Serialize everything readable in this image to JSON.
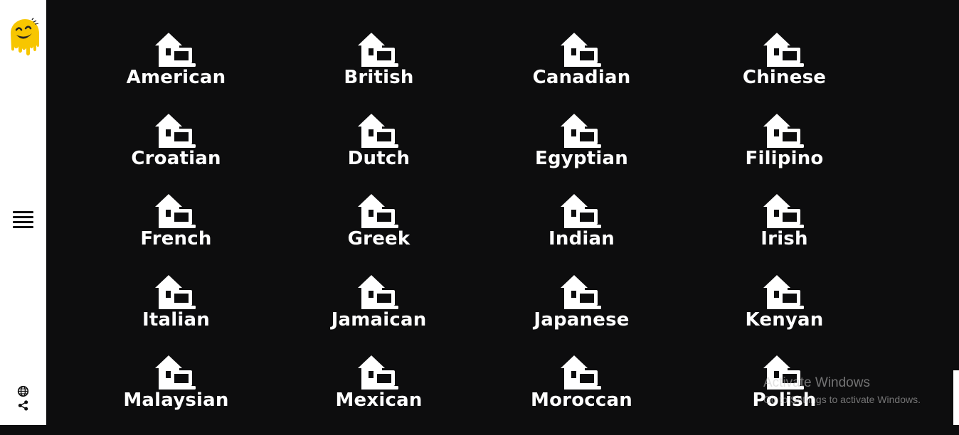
{
  "sidebar": {
    "logo": "smiling-dripping-face-logo",
    "menu_icon": "hamburger-menu-icon",
    "globe_icon": "globe-icon",
    "share_icon": "share-icon",
    "logo_color": "#f7c600"
  },
  "tile_icon": "home-laptop-icon",
  "cuisines": [
    "American",
    "British",
    "Canadian",
    "Chinese",
    "Croatian",
    "Dutch",
    "Egyptian",
    "Filipino",
    "French",
    "Greek",
    "Indian",
    "Irish",
    "Italian",
    "Jamaican",
    "Japanese",
    "Kenyan",
    "Malaysian",
    "Mexican",
    "Moroccan",
    "Polish"
  ],
  "watermark": {
    "title": "Activate Windows",
    "subtitle": "Go to Settings to activate Windows."
  },
  "colors": {
    "background": "#0d0d0e",
    "sidebar": "#ffffff",
    "text": "#ffffff"
  }
}
